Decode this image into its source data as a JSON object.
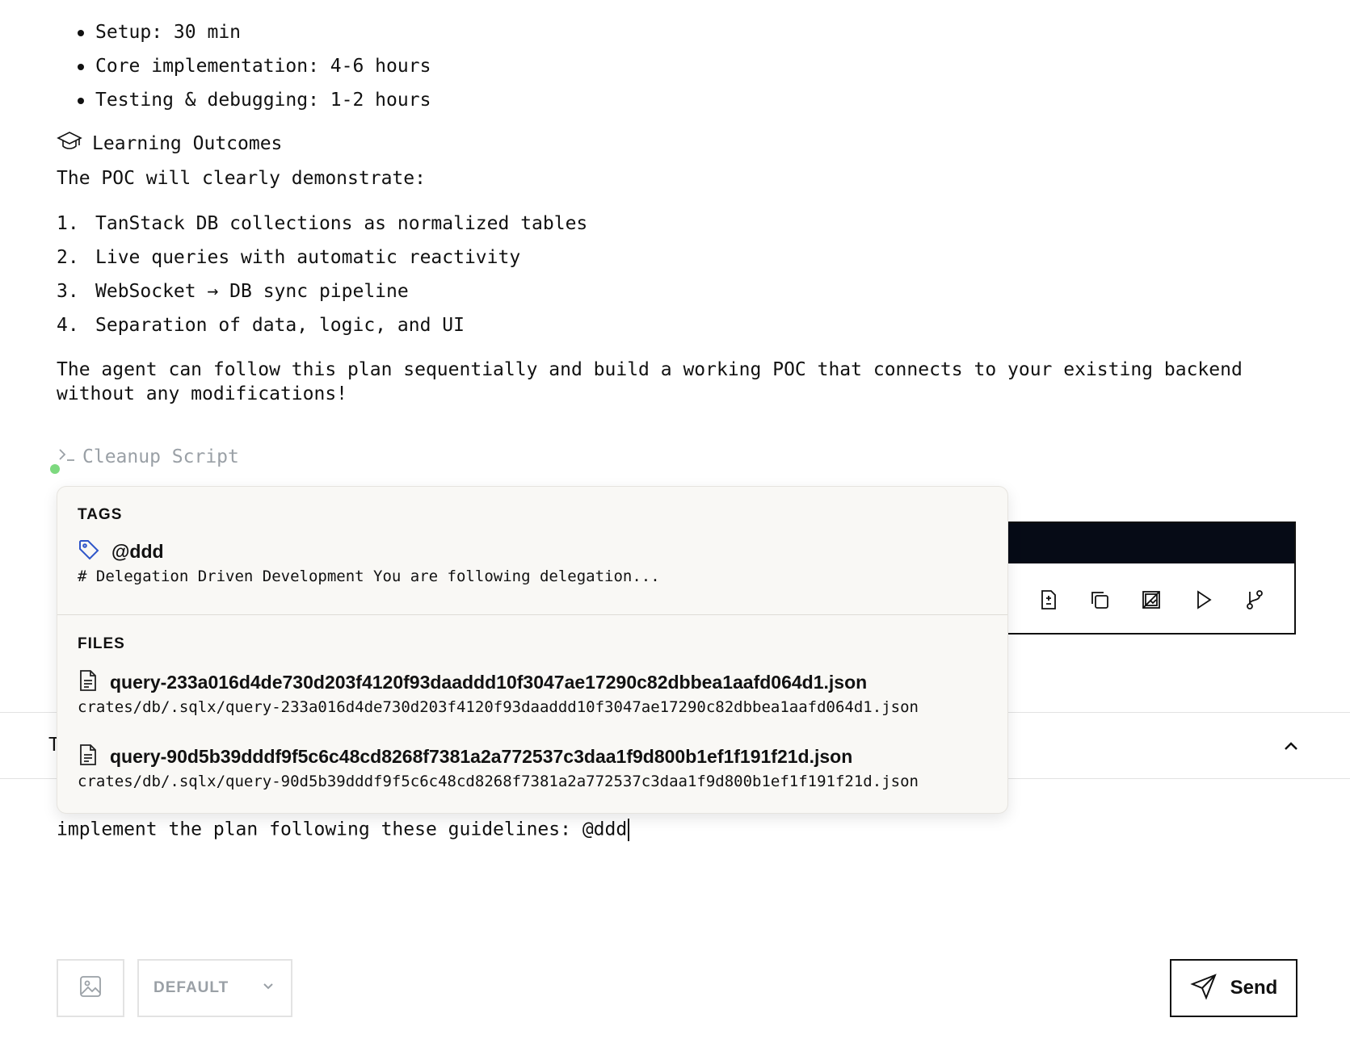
{
  "plan": {
    "timeline_items": [
      "Setup: 30 min",
      "Core implementation: 4-6 hours",
      "Testing & debugging: 1-2 hours"
    ],
    "learning_outcomes_heading": "Learning Outcomes",
    "learning_outcomes_icon": "graduation-cap-icon",
    "intro": "The POC will clearly demonstrate:",
    "outcomes": [
      {
        "num": "1.",
        "text": "TanStack DB collections as normalized tables"
      },
      {
        "num": "2.",
        "text": "Live queries with automatic reactivity"
      },
      {
        "num": "3.",
        "text": "WebSocket → DB sync pipeline"
      },
      {
        "num": "4.",
        "text": "Separation of data, logic, and UI"
      }
    ],
    "closing": "The agent can follow this plan sequentially and build a working POC that connects to your existing backend without any modifications!"
  },
  "cleanup": {
    "label": "Cleanup Script",
    "icon": "terminal-icon"
  },
  "toolbar": {
    "icons": [
      "file-diff-icon",
      "copy-icon",
      "image-off-icon",
      "play-icon",
      "git-branch-icon"
    ]
  },
  "band": {
    "letter": "T"
  },
  "popup": {
    "tags_title": "TAGS",
    "tags": [
      {
        "name": "@ddd",
        "description": "# Delegation Driven Development You are following delegation...",
        "icon": "tag-icon"
      }
    ],
    "files_title": "FILES",
    "files": [
      {
        "name": "query-233a016d4de730d203f4120f93daaddd10f3047ae17290c82dbbea1aafd064d1.json",
        "path": "crates/db/.sqlx/query-233a016d4de730d203f4120f93daaddd10f3047ae17290c82dbbea1aafd064d1.json",
        "icon": "file-icon"
      },
      {
        "name": "query-90d5b39dddf9f5c6c48cd8268f7381a2a772537c3daa1f9d800b1ef1f191f21d.json",
        "path": "crates/db/.sqlx/query-90d5b39dddf9f5c6c48cd8268f7381a2a772537c3daa1f9d800b1ef1f191f21d.json",
        "icon": "file-icon"
      }
    ]
  },
  "prompt": {
    "value": "implement the plan following these guidelines: @ddd"
  },
  "controls": {
    "mode": "DEFAULT",
    "send_label": "Send"
  },
  "colors": {
    "accent_tag": "#2f56c9",
    "status_dot": "#7dd97f",
    "dark_bar": "#060b16"
  }
}
